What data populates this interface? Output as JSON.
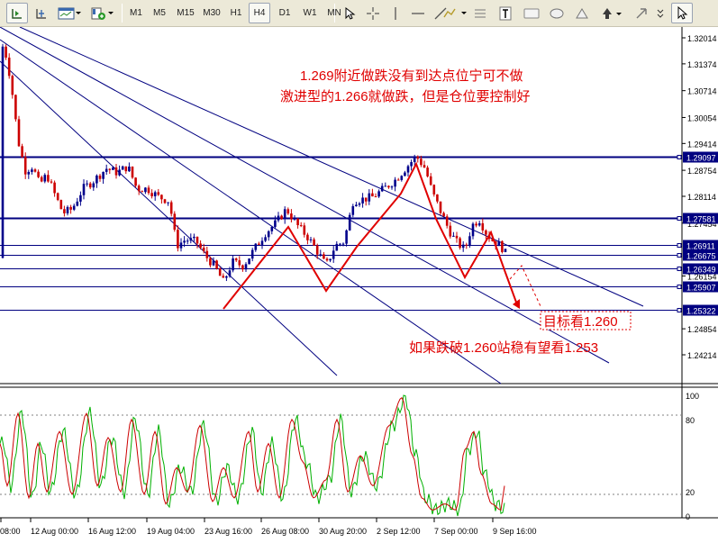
{
  "toolbar": {
    "timeframes": [
      "M1",
      "M5",
      "M15",
      "M30",
      "H1",
      "H4",
      "D1",
      "W1",
      "MN"
    ],
    "active_timeframe": "H4",
    "icons": [
      "chart-bars-icon",
      "chart-crosshair-icon",
      "chart-template-icon",
      "indicators-icon",
      "cursor-icon",
      "crosshair-icon",
      "vertical-line-icon",
      "horizontal-line-icon",
      "trendline-icon",
      "fibo-icon",
      "text-icon",
      "text-label-icon",
      "rectangle-icon",
      "ellipse-icon",
      "triangle-icon",
      "arrow-icon"
    ]
  },
  "price_axis": {
    "labels": [
      "1.32014",
      "1.31374",
      "1.30714",
      "1.30054",
      "1.29414",
      "1.28754",
      "1.28114",
      "1.27454",
      "1.26154",
      "1.24854",
      "1.24214"
    ],
    "levels": [
      {
        "value": "1.29097",
        "color": "#000080"
      },
      {
        "value": "1.27581",
        "color": "#000080"
      },
      {
        "value": "1.26911",
        "color": "#000080"
      },
      {
        "value": "1.26675",
        "color": "#000080"
      },
      {
        "value": "1.26349",
        "color": "#000080"
      },
      {
        "value": "1.25907",
        "color": "#000080"
      },
      {
        "value": "1.25322",
        "color": "#000080"
      }
    ]
  },
  "annotations": {
    "line1": "1.269附近做跌没有到达点位宁可不做",
    "line2": "激进型的1.266就做跌，但是仓位要控制好",
    "target": "目标看1.260",
    "break": "如果跌破1.260站稳有望看1.253"
  },
  "oscillator": {
    "labels": [
      "100",
      "80",
      "20",
      "0"
    ],
    "main_color": "#cc0000",
    "signal_color": "#00b000"
  },
  "time_axis": {
    "labels": [
      "08:00",
      "12 Aug 00:00",
      "16 Aug 12:00",
      "19 Aug 04:00",
      "23 Aug 16:00",
      "26 Aug 08:00",
      "30 Aug 20:00",
      "2 Sep 12:00",
      "7 Sep 00:00",
      "9 Sep 16:00"
    ]
  },
  "colors": {
    "bull_candle": "#00008b",
    "bear_candle": "#cc0000",
    "level_line": "#000080",
    "annotation_red": "#e00000",
    "zigzag": "#e00000"
  }
}
